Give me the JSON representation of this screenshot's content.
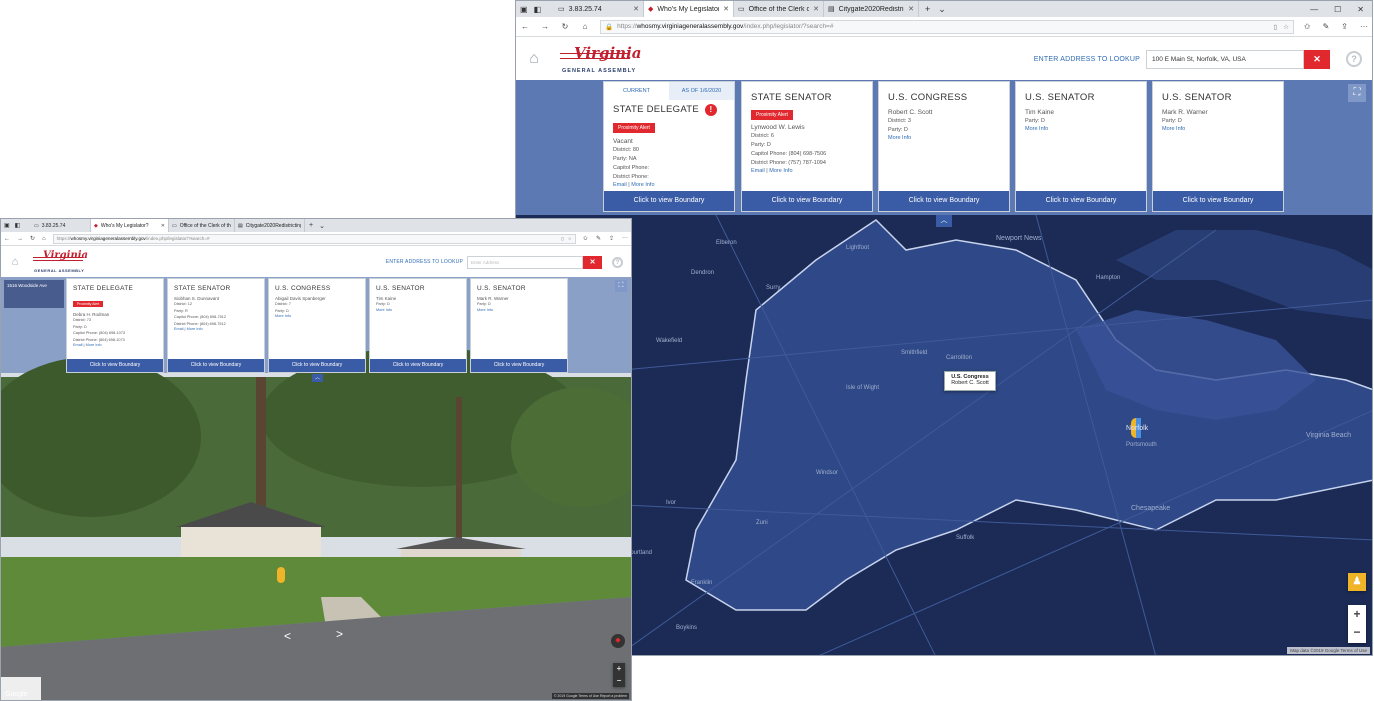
{
  "front": {
    "tabs": [
      {
        "label": "3.83.25.74",
        "active": false
      },
      {
        "label": "Who's My Legislator?",
        "active": true
      },
      {
        "label": "Office of the Clerk of the U.",
        "active": false
      },
      {
        "label": "Citygate2020Redistricting.p",
        "active": false
      }
    ],
    "url": {
      "prefix": "https://",
      "domain": "whosmy.virginiageneralassembly.gov",
      "rest": "/index.php/legislator/?search=#"
    },
    "site": {
      "logo_script": "Virginia",
      "logo_sub": "GENERAL ASSEMBLY",
      "enter_label": "ENTER ADDRESS TO LOOKUP",
      "address_value": "100 E Main St, Norfolk, VA, USA",
      "clear_glyph": "✕",
      "help_glyph": "?"
    },
    "card_tabs": {
      "current": "CURRENT",
      "asof": "AS OF 1/6/2020"
    },
    "cards": [
      {
        "title": "STATE DELEGATE",
        "alert": "Proximity Alert",
        "name": "Vacant",
        "lines": [
          "District: 80",
          "Party: NA",
          "Capitol Phone:",
          "District Phone:"
        ],
        "email": "Email",
        "more": "More Info",
        "button": "Click to view Boundary"
      },
      {
        "title": "STATE SENATOR",
        "alert": "Proximity Alert",
        "name": "Lynwood W. Lewis",
        "lines": [
          "District: 6",
          "Party: D",
          "Capitol Phone: (804) 698-7506",
          "District Phone: (757) 787-1094"
        ],
        "email": "Email",
        "more": "More Info",
        "button": "Click to view Boundary"
      },
      {
        "title": "U.S. CONGRESS",
        "name": "Robert C. Scott",
        "lines": [
          "District: 3",
          "Party: D"
        ],
        "more": "More Info",
        "button": "Click to view Boundary"
      },
      {
        "title": "U.S. SENATOR",
        "name": "Tim Kaine",
        "lines": [
          "Party: D"
        ],
        "more": "More Info",
        "button": "Click to view Boundary"
      },
      {
        "title": "U.S. SENATOR",
        "name": "Mark R. Warner",
        "lines": [
          "Party: D"
        ],
        "more": "More Info",
        "button": "Click to view Boundary"
      }
    ],
    "map_popup": {
      "line1": "U.S. Congress",
      "line2": "Robert C. Scott"
    },
    "map_labels": [
      "Newport News",
      "Hampton",
      "Portsmouth",
      "Norfolk",
      "Virginia Beach",
      "Chesapeake",
      "Suffolk",
      "Isle of Wight",
      "Smithfield",
      "Carrollton",
      "Windsor",
      "Zuni",
      "Ivor",
      "Franklin",
      "Courtland",
      "Boykins",
      "Wakefield",
      "Surry",
      "Elberon",
      "Dendron",
      "Lightfoot"
    ],
    "credit": "Map data ©2019 Google   Terms of Use"
  },
  "back": {
    "tabs": [
      {
        "label": "3.83.25.74",
        "active": false
      },
      {
        "label": "Who's My Legislator?",
        "active": true
      },
      {
        "label": "Office of the Clerk of the U.",
        "active": false
      },
      {
        "label": "Citygate2020Redistricting.p",
        "active": false
      }
    ],
    "url": {
      "prefix": "https://",
      "domain": "whosmy.virginiageneralassembly.gov",
      "rest": "/index.php/legislator/?search=#"
    },
    "site": {
      "logo_script": "Virginia",
      "logo_sub": "GENERAL ASSEMBLY",
      "enter_label": "ENTER ADDRESS TO LOOKUP",
      "address_placeholder": "Enter Address",
      "clear_glyph": "✕",
      "help_glyph": "?"
    },
    "streetview_label": "1516 Woodside Ave",
    "cards": [
      {
        "title": "STATE DELEGATE",
        "alert": "Proximity Alert",
        "name": "Debra H. Rodman",
        "lines": [
          "District: 73",
          "Party: D",
          "Capitol Phone: (804) 698-1073",
          "District Phone: (804) 698-1073"
        ],
        "email": "Email",
        "more": "More Info",
        "button": "Click to view Boundary"
      },
      {
        "title": "STATE SENATOR",
        "name": "Siobhan S. Dunnavant",
        "lines": [
          "District: 12",
          "Party: R",
          "Capitol Phone: (804) 698-7512",
          "District Phone: (804) 698-7512"
        ],
        "email": "Email",
        "more": "More Info",
        "button": "Click to view Boundary"
      },
      {
        "title": "U.S. CONGRESS",
        "name": "Abigail Davis Spanberger",
        "lines": [
          "District: 7",
          "Party: D"
        ],
        "more": "More Info",
        "button": "Click to view Boundary"
      },
      {
        "title": "U.S. SENATOR",
        "name": "Tim Kaine",
        "lines": [
          "Party: D"
        ],
        "more": "More Info",
        "button": "Click to view Boundary"
      },
      {
        "title": "U.S. SENATOR",
        "name": "Mark R. Warner",
        "lines": [
          "Party: D"
        ],
        "more": "More Info",
        "button": "Click to view Boundary"
      }
    ],
    "google_logo": "Google",
    "credit": "© 2019 Google   Terms of Use   Report a problem"
  }
}
